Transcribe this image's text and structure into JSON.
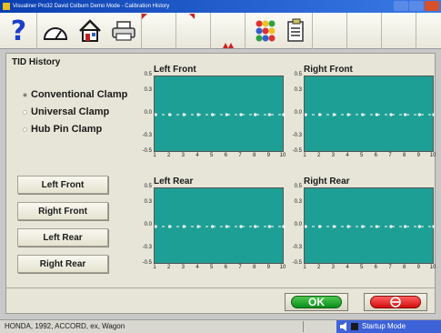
{
  "window": {
    "title": "Visualiner Pro32   David Colburn   Demo Mode   -   Calibration History"
  },
  "toolbar": {
    "icons": [
      "help-icon",
      "gauge-icon",
      "home-icon",
      "printer-icon",
      "options-icon",
      "list-icon"
    ],
    "help_glyph": "?"
  },
  "page": {
    "heading": "TID History"
  },
  "clamp_options": [
    {
      "label": "Conventional Clamp",
      "selected": true
    },
    {
      "label": "Universal Clamp",
      "selected": false
    },
    {
      "label": "Hub Pin Clamp",
      "selected": false
    }
  ],
  "side_buttons": [
    "Left Front",
    "Right Front",
    "Left Rear",
    "Right Rear"
  ],
  "charts": [
    {
      "title": "Left Front"
    },
    {
      "title": "Right Front"
    },
    {
      "title": "Left Rear"
    },
    {
      "title": "Right Rear"
    }
  ],
  "chart_data": [
    {
      "type": "line",
      "title": "Left Front",
      "xlabel": "",
      "ylabel": "",
      "x": [
        1,
        2,
        3,
        4,
        5,
        6,
        7,
        8,
        9,
        10
      ],
      "values": [
        0,
        0,
        0,
        0,
        0,
        0,
        0,
        0,
        0,
        0
      ],
      "ylim": [
        -0.5,
        0.5
      ],
      "yticks": [
        "0.5",
        "0.3",
        "0.0",
        "-0.3",
        "-0.5"
      ],
      "xticks": [
        "1",
        "2",
        "3",
        "4",
        "5",
        "6",
        "7",
        "8",
        "9",
        "10"
      ]
    },
    {
      "type": "line",
      "title": "Right Front",
      "xlabel": "",
      "ylabel": "",
      "x": [
        1,
        2,
        3,
        4,
        5,
        6,
        7,
        8,
        9,
        10
      ],
      "values": [
        0,
        0,
        0,
        0,
        0,
        0,
        0,
        0,
        0,
        0
      ],
      "ylim": [
        -0.5,
        0.5
      ],
      "yticks": [
        "0.5",
        "0.3",
        "0.0",
        "-0.3",
        "-0.5"
      ],
      "xticks": [
        "1",
        "2",
        "3",
        "4",
        "5",
        "6",
        "7",
        "8",
        "9",
        "10"
      ]
    },
    {
      "type": "line",
      "title": "Left Rear",
      "xlabel": "",
      "ylabel": "",
      "x": [
        1,
        2,
        3,
        4,
        5,
        6,
        7,
        8,
        9,
        10
      ],
      "values": [
        0,
        0,
        0,
        0,
        0,
        0,
        0,
        0,
        0,
        0
      ],
      "ylim": [
        -0.5,
        0.5
      ],
      "yticks": [
        "0.5",
        "0.3",
        "0.0",
        "-0.3",
        "-0.5"
      ],
      "xticks": [
        "1",
        "2",
        "3",
        "4",
        "5",
        "6",
        "7",
        "8",
        "9",
        "10"
      ]
    },
    {
      "type": "line",
      "title": "Right Rear",
      "xlabel": "",
      "ylabel": "",
      "x": [
        1,
        2,
        3,
        4,
        5,
        6,
        7,
        8,
        9,
        10
      ],
      "values": [
        0,
        0,
        0,
        0,
        0,
        0,
        0,
        0,
        0,
        0
      ],
      "ylim": [
        -0.5,
        0.5
      ],
      "yticks": [
        "0.5",
        "0.3",
        "0.0",
        "-0.3",
        "-0.5"
      ],
      "xticks": [
        "1",
        "2",
        "3",
        "4",
        "5",
        "6",
        "7",
        "8",
        "9",
        "10"
      ]
    }
  ],
  "footer": {
    "ok_label": "OK",
    "cancel_icon": "no-entry-icon"
  },
  "status": {
    "vehicle": "HONDA, 1992, ACCORD, ex, Wagon",
    "mode": "Startup Mode"
  },
  "colors": {
    "plot_bg": "#1e9f95",
    "ok_green": "#0b8d1b",
    "cancel_red": "#d00e0e",
    "title_blue": "#0a3fb0"
  }
}
